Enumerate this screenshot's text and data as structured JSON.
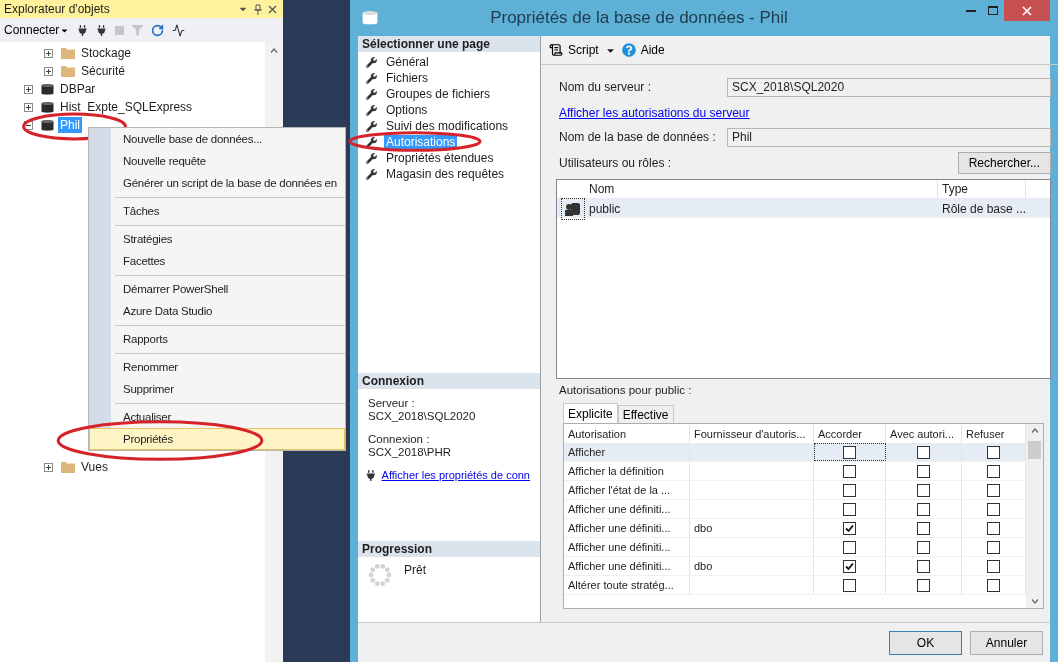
{
  "explorer": {
    "title": "Explorateur d'objets",
    "connect_label": "Connecter",
    "tree": [
      {
        "kind": "group",
        "children": [
          {
            "kind": "folder",
            "label": "Stockage",
            "expanded": false,
            "selected": false
          },
          {
            "kind": "folder",
            "label": "Sécurité",
            "expanded": false,
            "selected": false
          }
        ]
      },
      {
        "kind": "database",
        "label": "DBPar",
        "expanded": false,
        "selected": false
      },
      {
        "kind": "database",
        "label": "Hist_Expte_SQLExpress",
        "expanded": false,
        "selected": false
      },
      {
        "kind": "database",
        "label": "Phil",
        "expanded": true,
        "selected": true,
        "circled": true,
        "children": [
          {
            "kind": "folder",
            "label": "Vues",
            "expanded": false,
            "selected": false
          }
        ]
      }
    ]
  },
  "context_menu": {
    "items": [
      {
        "kind": "item",
        "label": "Nouvelle base de données...",
        "selected": false
      },
      {
        "kind": "item",
        "label": "Nouvelle requête",
        "selected": false
      },
      {
        "kind": "item",
        "label": "Générer un script de la base de données en",
        "selected": false
      },
      {
        "kind": "separator"
      },
      {
        "kind": "item",
        "label": "Tâches",
        "selected": false
      },
      {
        "kind": "separator"
      },
      {
        "kind": "item",
        "label": "Stratégies",
        "selected": false
      },
      {
        "kind": "item",
        "label": "Facettes",
        "selected": false
      },
      {
        "kind": "separator"
      },
      {
        "kind": "item",
        "label": "Démarrer PowerShell",
        "selected": false
      },
      {
        "kind": "item",
        "label": "Azure Data Studio",
        "selected": false
      },
      {
        "kind": "separator"
      },
      {
        "kind": "item",
        "label": "Rapports",
        "selected": false
      },
      {
        "kind": "separator"
      },
      {
        "kind": "item",
        "label": "Renommer",
        "selected": false
      },
      {
        "kind": "item",
        "label": "Supprimer",
        "selected": false
      },
      {
        "kind": "separator"
      },
      {
        "kind": "item",
        "label": "Actualiser",
        "selected": false
      },
      {
        "kind": "item",
        "label": "Propriétés",
        "selected": true,
        "circled": true
      }
    ]
  },
  "dialog": {
    "title": "Propriétés de la base de données - Phil",
    "page_list": {
      "heading": "Sélectionner une page",
      "pages": [
        {
          "label": "Général",
          "selected": false
        },
        {
          "label": "Fichiers",
          "selected": false
        },
        {
          "label": "Groupes de fichiers",
          "selected": false
        },
        {
          "label": "Options",
          "selected": false
        },
        {
          "label": "Suivi des modifications",
          "selected": false
        },
        {
          "label": "Autorisations",
          "selected": true,
          "circled": true
        },
        {
          "label": "Propriétés étendues",
          "selected": false
        },
        {
          "label": "Magasin des requêtes",
          "selected": false
        }
      ]
    },
    "connection": {
      "heading": "Connexion",
      "fields": [
        {
          "label": "Serveur :",
          "value": "SCX_2018\\SQL2020"
        },
        {
          "label": "Connexion :",
          "value": "SCX_2018\\PHR"
        }
      ],
      "link": "Afficher les propriétés de conn"
    },
    "progress": {
      "heading": "Progression",
      "status": "Prêt"
    },
    "toolbar": {
      "script": "Script",
      "help": "Aide"
    },
    "server_name": {
      "label": "Nom du serveur :",
      "value": "SCX_2018\\SQL2020"
    },
    "server_link": "Afficher les autorisations du serveur",
    "database_name": {
      "label": "Nom de la base de données :",
      "value": "Phil"
    },
    "users": {
      "label": "Utilisateurs ou rôles :",
      "search_button": "Rechercher...",
      "columns": [
        "Nom",
        "Type"
      ],
      "rows": [
        {
          "name": "public",
          "type": "Rôle de base ...",
          "selected": true
        }
      ]
    },
    "permissions": {
      "label": "Autorisations pour public :",
      "tabs": [
        {
          "label": "Explicite",
          "selected": true
        },
        {
          "label": "Effective",
          "selected": false
        }
      ],
      "columns": [
        "Autorisation",
        "Fournisseur d'autoris...",
        "Accorder",
        "Avec autori...",
        "Refuser"
      ],
      "rows": [
        {
          "name": "Afficher",
          "grantor": "",
          "grant": false,
          "with_grant": false,
          "deny": false,
          "selected": true
        },
        {
          "name": "Afficher la définition",
          "grantor": "",
          "grant": false,
          "with_grant": false,
          "deny": false,
          "selected": false
        },
        {
          "name": "Afficher l'état de la ...",
          "grantor": "",
          "grant": false,
          "with_grant": false,
          "deny": false,
          "selected": false
        },
        {
          "name": "Afficher une définiti...",
          "grantor": "",
          "grant": false,
          "with_grant": false,
          "deny": false,
          "selected": false
        },
        {
          "name": "Afficher une définiti...",
          "grantor": "dbo",
          "grant": true,
          "with_grant": false,
          "deny": false,
          "selected": false
        },
        {
          "name": "Afficher une définiti...",
          "grantor": "",
          "grant": false,
          "with_grant": false,
          "deny": false,
          "selected": false
        },
        {
          "name": "Afficher une définiti...",
          "grantor": "dbo",
          "grant": true,
          "with_grant": false,
          "deny": false,
          "selected": false
        },
        {
          "name": "Altérer toute stratég...",
          "grantor": "",
          "grant": false,
          "with_grant": false,
          "deny": false,
          "selected": false
        }
      ]
    },
    "buttons": [
      {
        "label": "OK",
        "default": true
      },
      {
        "label": "Annuler",
        "default": false
      }
    ]
  }
}
